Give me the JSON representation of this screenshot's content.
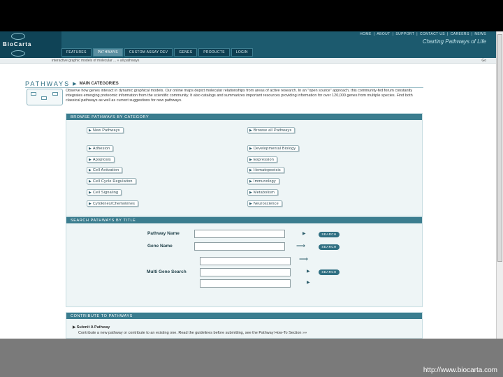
{
  "header": {
    "logo": "BioCarta",
    "top_links": [
      "HOME",
      "|",
      "ABOUT",
      "|",
      "SUPPORT",
      "|",
      "CONTACT US",
      "|",
      "CAREERS",
      "|",
      "NEWS"
    ],
    "tagline": "Charting Pathways of Life",
    "tabs": [
      {
        "label": "FEATURES",
        "active": false
      },
      {
        "label": "PATHWAYS",
        "active": true
      },
      {
        "label": "CUSTOM ASSAY DEV",
        "active": false
      },
      {
        "label": "GENES",
        "active": false
      },
      {
        "label": "PRODUCTS",
        "active": false
      },
      {
        "label": "LOGIN",
        "active": false
      }
    ],
    "breadcrumb": "interactive graphic models of molecular ... » all pathways",
    "lang": "Go"
  },
  "page": {
    "title": "PATHWAYS",
    "subtitle": "MAIN CATEGORIES",
    "intro": "Observe how genes interact in dynamic graphical models. Our online maps depict molecular relationships from areas of active research. In an \"open source\" approach, this community-fed forum constantly integrates emerging proteomic information from the scientific community. It also catalogs and summarizes important resources providing information for over 120,000 genes from multiple species. Find both classical pathways as well as current suggestions for new pathways."
  },
  "browse": {
    "header": "BROWSE PATHWAYS BY CATEGORY",
    "top_left": "New Pathways",
    "top_right": "Browse all Pathways",
    "left": [
      "Adhesion",
      "Apoptosis",
      "Cell Activation",
      "Cell Cycle Regulation",
      "Cell Signaling",
      "Cytokines/Chemokines"
    ],
    "right": [
      "Developmental Biology",
      "Expression",
      "Hematopoeisis",
      "Immunology",
      "Metabolism",
      "Neuroscience"
    ]
  },
  "search": {
    "header": "SEARCH PATHWAYS BY TITLE",
    "pathway_label": "Pathway Name",
    "gene_label": "Gene Name",
    "multi_label": "Multi Gene Search",
    "button": "SEARCH"
  },
  "contribute": {
    "header": "CONTRIBUTE TO PATHWAYS",
    "item_title": "Submit A Pathway",
    "item_text": "Contribute a new pathway or contribute to an existing one. Read the guidelines before submitting, see the Pathway How-To Section »»"
  },
  "footer": {
    "url": "http://www.biocarta.com"
  }
}
